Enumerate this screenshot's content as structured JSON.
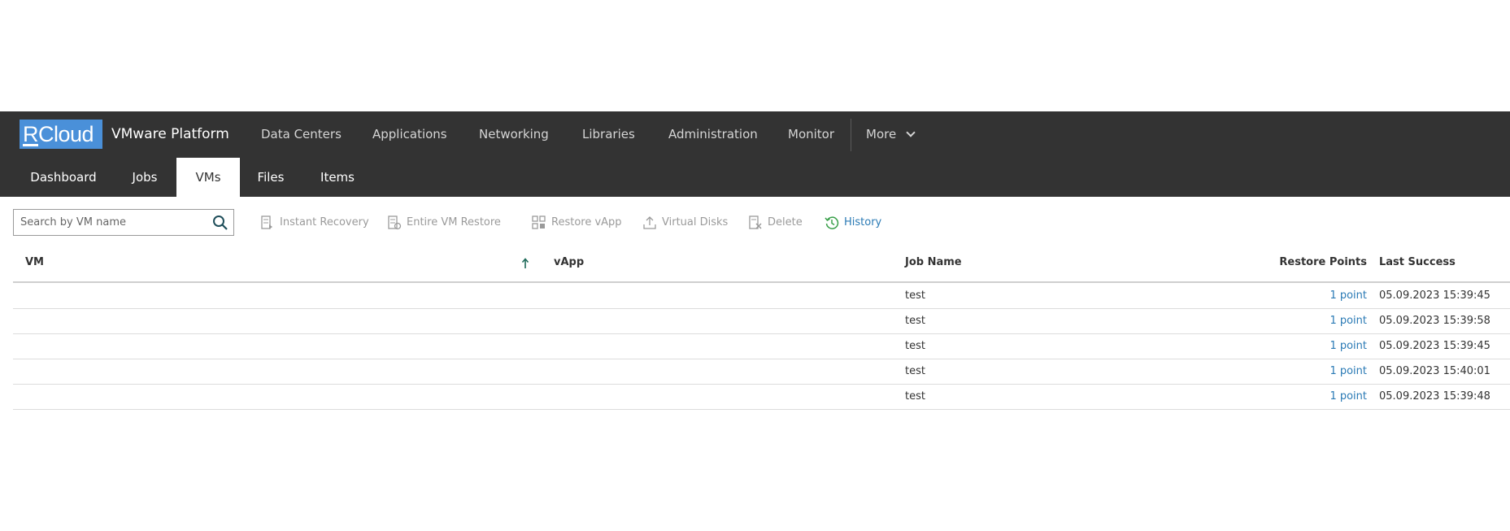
{
  "header": {
    "logo_text_first": "R",
    "logo_text_rest": "Cloud",
    "app_title": "VMware Platform",
    "nav": [
      "Data Centers",
      "Applications",
      "Networking",
      "Libraries",
      "Administration",
      "Monitor"
    ],
    "more_label": "More"
  },
  "tabs": [
    {
      "label": "Dashboard",
      "active": false
    },
    {
      "label": "Jobs",
      "active": false
    },
    {
      "label": "VMs",
      "active": true
    },
    {
      "label": "Files",
      "active": false
    },
    {
      "label": "Items",
      "active": false
    }
  ],
  "search": {
    "placeholder": "Search by VM name",
    "value": ""
  },
  "toolbar": {
    "instant_recovery": "Instant Recovery",
    "entire_vm_restore": "Entire VM Restore",
    "restore_vapp": "Restore vApp",
    "virtual_disks": "Virtual Disks",
    "delete": "Delete",
    "history": "History"
  },
  "colors": {
    "topbar": "#333333",
    "brand": "#4a90d9",
    "link": "#2a7ab5",
    "history_icon": "#3aa04a",
    "sort_arrow": "#1f6b5a"
  },
  "grid": {
    "columns": {
      "vm": "VM",
      "vapp": "vApp",
      "job_name": "Job Name",
      "restore_points": "Restore Points",
      "last_success": "Last Success"
    },
    "sort": {
      "column": "VM",
      "direction": "ascending"
    },
    "rows": [
      {
        "vm": "",
        "vapp": "",
        "job_name": "test",
        "restore_points": "1 point",
        "last_success": "05.09.2023 15:39:45"
      },
      {
        "vm": "",
        "vapp": "",
        "job_name": "test",
        "restore_points": "1 point",
        "last_success": "05.09.2023 15:39:58"
      },
      {
        "vm": "",
        "vapp": "",
        "job_name": "test",
        "restore_points": "1 point",
        "last_success": "05.09.2023 15:39:45"
      },
      {
        "vm": "",
        "vapp": "",
        "job_name": "test",
        "restore_points": "1 point",
        "last_success": "05.09.2023 15:40:01"
      },
      {
        "vm": "",
        "vapp": "",
        "job_name": "test",
        "restore_points": "1 point",
        "last_success": "05.09.2023 15:39:48"
      }
    ]
  }
}
